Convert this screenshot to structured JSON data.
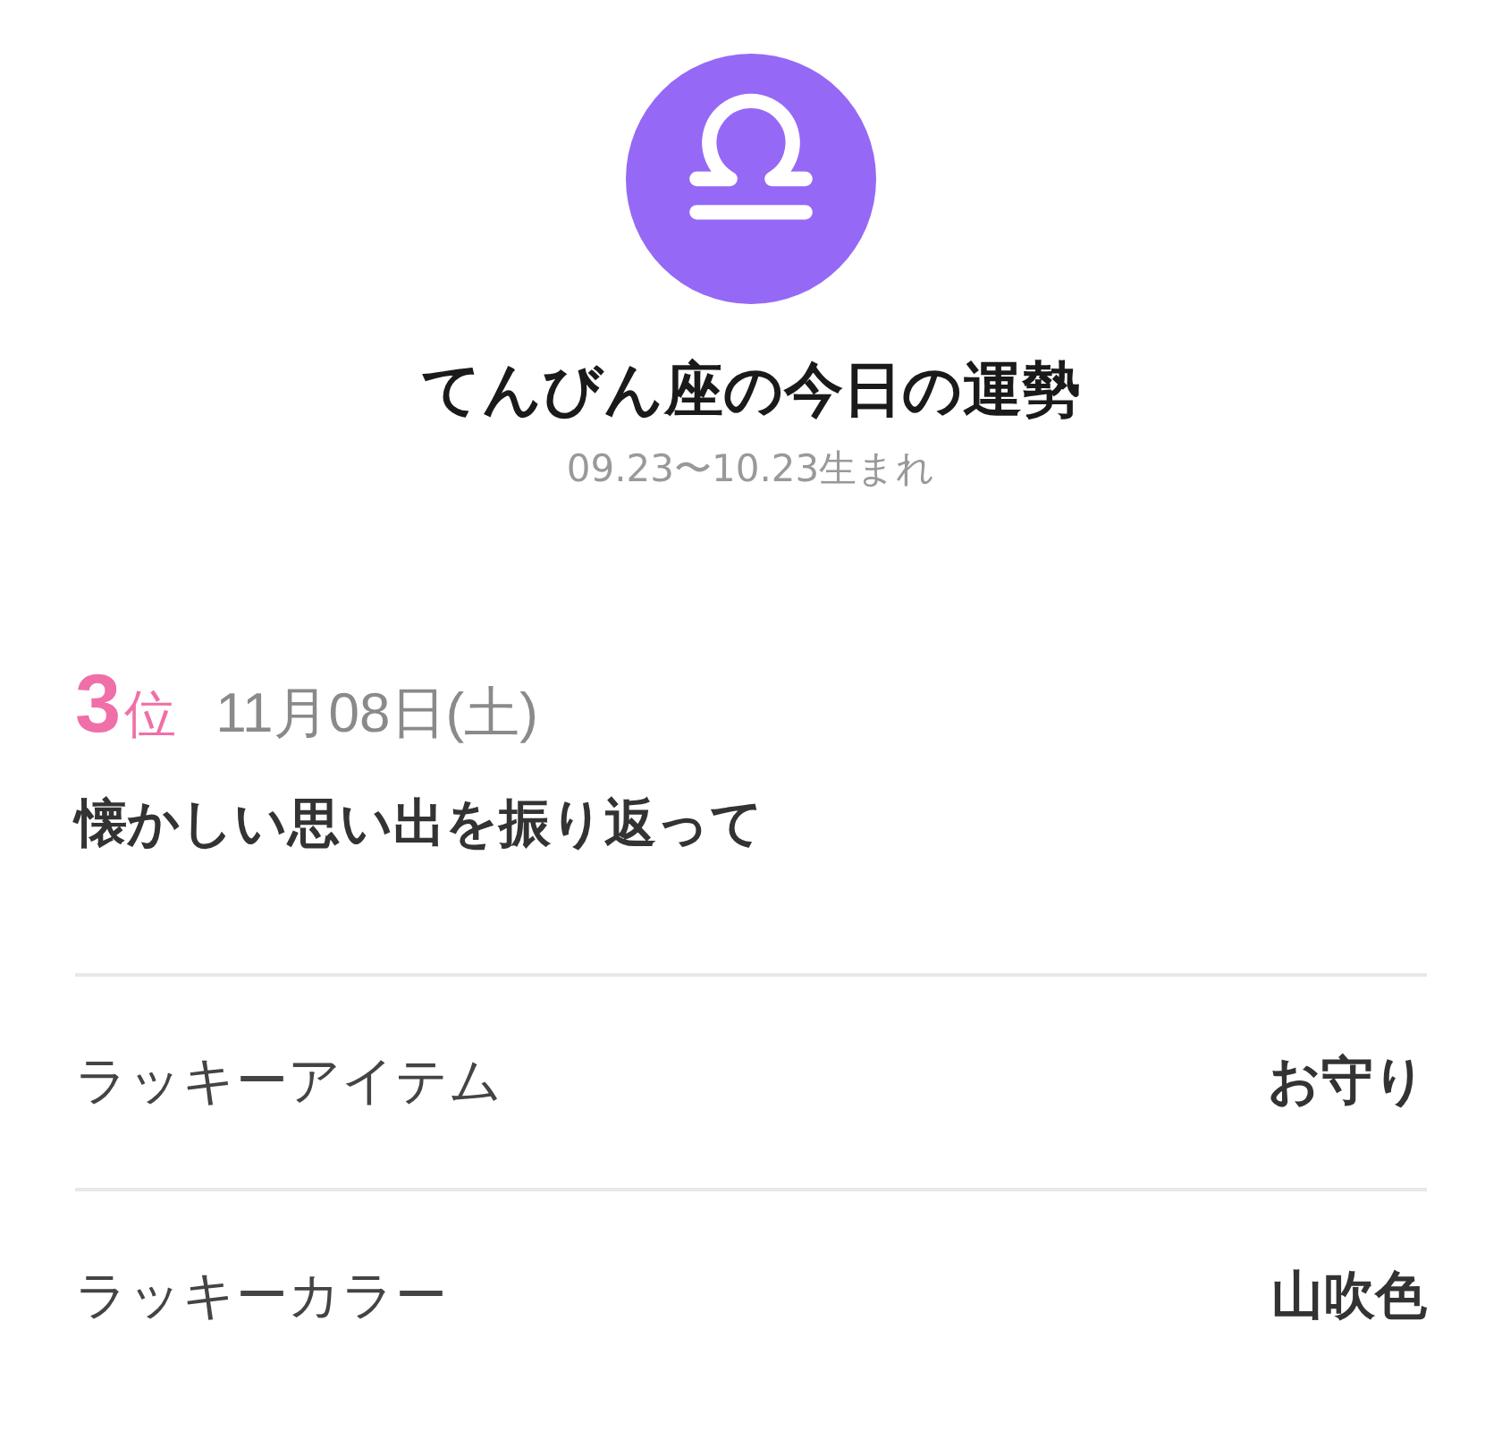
{
  "sign": {
    "kind": "libra",
    "title": "てんびん座の今日の運勢",
    "period": "09.23〜10.23生まれ"
  },
  "rank": {
    "number": "3",
    "suffix": "位",
    "date": "11月08日(土)"
  },
  "message": "懐かしい思い出を振り返って",
  "lucky": [
    {
      "label": "ラッキーアイテム",
      "value": "お守り"
    },
    {
      "label": "ラッキーカラー",
      "value": "山吹色"
    }
  ]
}
